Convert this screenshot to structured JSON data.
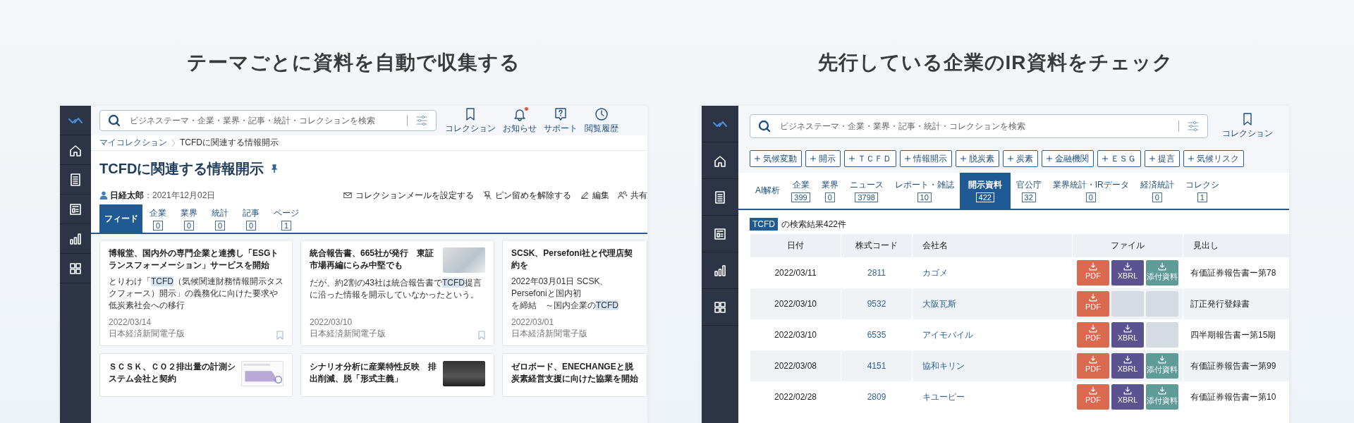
{
  "left_panel": {
    "heading": "テーマごとに資料を自動で収集する",
    "search": {
      "placeholder": "ビジネステーマ・企業・業界・記事・統計・コレクションを検索"
    },
    "header_nav": [
      {
        "label": "コレクション",
        "alert": false
      },
      {
        "label": "お知らせ",
        "alert": true
      },
      {
        "label": "サポート",
        "alert": false
      },
      {
        "label": "閲覧履歴",
        "alert": false
      }
    ],
    "breadcrumb": [
      "マイコレクション",
      "TCFDに関連する情報開示"
    ],
    "title": "TCFDに関連する情報開示",
    "pinned": true,
    "author": "日経太郎",
    "date": "：2021年12月02日",
    "actions": [
      "コレクションメールを設定する",
      "ピン留めを解除する",
      "編集",
      "共有"
    ],
    "tabs": [
      {
        "label": "フィード",
        "selected": true
      },
      {
        "label": "企業",
        "count": "0",
        "selected": false
      },
      {
        "label": "業界",
        "count": "0",
        "selected": false
      },
      {
        "label": "統計",
        "count": "0",
        "selected": false
      },
      {
        "label": "記事",
        "count": "0",
        "selected": false
      },
      {
        "label": "ページ",
        "count": "1",
        "selected": false
      }
    ],
    "cards": [
      {
        "title": "博報堂、国内外の専門企業と連携し「ESGトランスフォーメーション」サービスを開始",
        "snippet": [
          {
            "text": "とりわけ「"
          },
          {
            "text": "TCFD",
            "highlight": true
          },
          {
            "text": "（気候関連財務情報開示タスクフォース）開示」の義務化に向けた要求や低炭素社会への移行"
          }
        ],
        "date": "2022/03/14",
        "source": "日本経済新聞電子版",
        "bookmarked": false
      },
      {
        "title": "統合報告書、665社が発行　東証市場再編にらみ中堅でも",
        "thumbnail": {
          "kind": "photo"
        },
        "snippet": [
          {
            "text": "だが、約2割の43社は統合報告書で"
          },
          {
            "text": "TCFD",
            "highlight": true
          },
          {
            "text": "提言に沿った情報を開示していなかったという。"
          }
        ],
        "date": "2022/03/10",
        "source": "日本経済新聞電子版",
        "bookmarked": false
      },
      {
        "title": "SCSK、Persefoni社と代理店契約を",
        "snippet": [
          {
            "text": "2022年03月01日 SCSK、Persefoniと国内初"
          },
          {
            "text": "を締結　～国内企業の",
            "newline": true
          },
          {
            "text": "TCFD",
            "highlight": true
          }
        ],
        "date": "2022/03/01",
        "source": "日本経済新聞電子版"
      },
      {
        "title": "ＳＣＳＫ、ＣＯ２排出量の計測システム会社と契約",
        "thumbnail": {
          "kind": "chart"
        }
      },
      {
        "title": "シナリオ分析に産業特性反映　排出削減、脱「形式主義」",
        "thumbnail": {
          "kind": "photo"
        }
      },
      {
        "title": "ゼロボード、ENECHANGEと脱炭素経営支援に向けた協業を開始"
      }
    ]
  },
  "right_panel": {
    "heading": "先行している企業のIR資料をチェック",
    "search": {
      "placeholder": "ビジネステーマ・企業・業界・記事・統計・コレクションを検索"
    },
    "header_nav": [
      {
        "label": "コレクション",
        "alert": false
      }
    ],
    "tags": [
      "気候変動",
      "開示",
      "ＴＣＦＤ",
      "情報開示",
      "脱炭素",
      "炭素",
      "金融機関",
      "ＥＳＧ",
      "提言",
      "気候リスク"
    ],
    "tabs": [
      {
        "label": "AI解析",
        "selected": false
      },
      {
        "label": "企業",
        "count": "399",
        "selected": false
      },
      {
        "label": "業界",
        "count": "0",
        "selected": false
      },
      {
        "label": "ニュース",
        "count": "3798",
        "selected": false
      },
      {
        "label": "レポート・雑誌",
        "count": "10",
        "selected": false
      },
      {
        "label": "開示資料",
        "count": "422",
        "selected": true
      },
      {
        "label": "官公庁",
        "count": "32",
        "selected": false
      },
      {
        "label": "業界統計・IRデータ",
        "count": "0",
        "selected": false
      },
      {
        "label": "経済統計",
        "count": "0",
        "selected": false
      },
      {
        "label": "コレクシ",
        "count": "1",
        "selected": false
      }
    ],
    "result": {
      "keyword": "TCFD",
      "text": "の検索結果422件"
    },
    "table": {
      "columns": [
        "日付",
        "株式コード",
        "会社名",
        "ファイル",
        "見出し"
      ],
      "rows": [
        {
          "date": "2022/03/11",
          "code": "2811",
          "company": "カゴメ",
          "files": [
            {
              "kind": "pdf",
              "available": true,
              "label": "PDF"
            },
            {
              "kind": "xbrl",
              "available": true,
              "label": "XBRL"
            },
            {
              "kind": "attachment",
              "available": true,
              "label": "添付資料"
            }
          ],
          "headline": "有価証券報告書ー第78"
        },
        {
          "date": "2022/03/10",
          "code": "9532",
          "company": "大阪瓦斯",
          "files": [
            {
              "kind": "pdf",
              "available": true,
              "label": "PDF"
            },
            {
              "kind": "xbrl",
              "available": false
            },
            {
              "kind": "attachment",
              "available": false
            }
          ],
          "headline": "訂正発行登録書"
        },
        {
          "date": "2022/03/10",
          "code": "6535",
          "company": "アイモバイル",
          "files": [
            {
              "kind": "pdf",
              "available": true,
              "label": "PDF"
            },
            {
              "kind": "xbrl",
              "available": true,
              "label": "XBRL"
            },
            {
              "kind": "attachment",
              "available": false
            }
          ],
          "headline": "四半期報告書ー第15期"
        },
        {
          "date": "2022/03/08",
          "code": "4151",
          "company": "協和キリン",
          "files": [
            {
              "kind": "pdf",
              "available": true,
              "label": "PDF"
            },
            {
              "kind": "xbrl",
              "available": true,
              "label": "XBRL"
            },
            {
              "kind": "attachment",
              "available": true,
              "label": "添付資料"
            }
          ],
          "headline": "有価証券報告書ー第99"
        },
        {
          "date": "2022/02/28",
          "code": "2809",
          "company": "キユーピー",
          "files": [
            {
              "kind": "pdf",
              "available": true,
              "label": "PDF"
            },
            {
              "kind": "xbrl",
              "available": true,
              "label": "XBRL"
            },
            {
              "kind": "attachment",
              "available": true,
              "label": "添付資料"
            }
          ],
          "headline": "有価証券報告書ー第10"
        }
      ]
    }
  }
}
